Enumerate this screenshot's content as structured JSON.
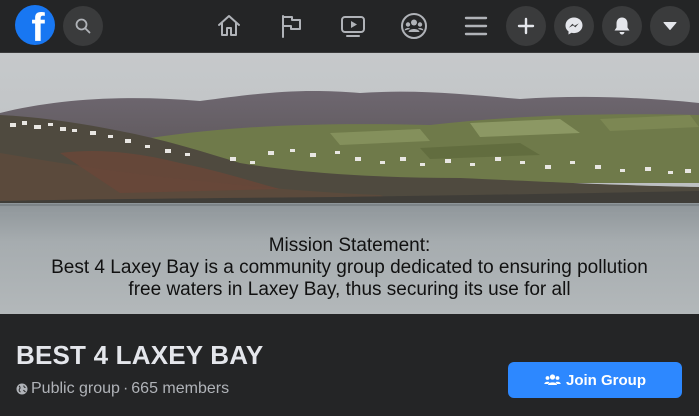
{
  "topbar": {
    "logo_letter": "f",
    "icons": {
      "logo": "facebook-logo",
      "search": "search-icon",
      "home": "home-icon",
      "pages": "flag-icon",
      "watch": "video-play-icon",
      "groups": "groups-icon",
      "menu": "hamburger-menu-icon",
      "create": "plus-icon",
      "messenger": "messenger-icon",
      "notifications": "bell-icon",
      "account": "caret-down-icon"
    }
  },
  "cover": {
    "mission_lines": [
      "Mission Statement:",
      "Best 4 Laxey Bay is a community group dedicated to ensuring pollution",
      "free waters in Laxey Bay, thus securing its use for all",
      "..."
    ]
  },
  "group": {
    "name": "BEST 4 LAXEY BAY",
    "privacy": "Public group",
    "separator": "·",
    "members": "665 members",
    "join_label": "Join Group"
  },
  "colors": {
    "background": "#242526",
    "nav_button": "#3a3b3c",
    "brand_blue": "#1877f2",
    "join_blue": "#2d88ff",
    "primary_text": "#e4e6eb",
    "secondary_text": "#b0b3b8"
  }
}
